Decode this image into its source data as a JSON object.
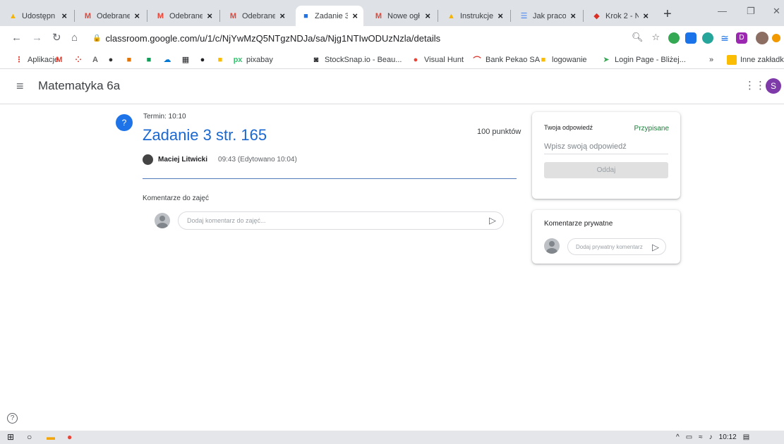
{
  "tabs": [
    {
      "title": "Udostępn",
      "icon": "google-drive-icon",
      "color": "#f4b400"
    },
    {
      "title": "Odebrane",
      "icon": "gmail-icon",
      "color": "#ea4335"
    },
    {
      "title": "Odebrane",
      "icon": "gmail-icon",
      "color": "#ea4335"
    },
    {
      "title": "Odebrane",
      "icon": "gmail-icon",
      "color": "#ea4335"
    },
    {
      "title": "Zadanie 3",
      "icon": "classroom-icon",
      "color": "#1e73e8"
    },
    {
      "title": "Nowe ogł",
      "icon": "gmail-icon",
      "color": "#ea4335"
    },
    {
      "title": "Instrukcje",
      "icon": "google-drive-icon",
      "color": "#f4b400"
    },
    {
      "title": "Jak pracow",
      "icon": "google-docs-icon",
      "color": "#4285f4"
    },
    {
      "title": "Krok 2 - N",
      "icon": "stepper-icon",
      "color": "#d93025"
    }
  ],
  "url": "classroom.google.com/u/1/c/NjYwMzQ5NTgzNDJa/sa/Njg1NTIwODUzNzla/details",
  "bookmarks": [
    {
      "label": "Aplikacje",
      "icon": "apps-icon",
      "color": "#ea4335"
    },
    {
      "label": "",
      "icon": "gmail-icon",
      "color": "#ea4335"
    },
    {
      "label": "",
      "icon": "dots-grid-icon",
      "color": "#d93025"
    },
    {
      "label": "",
      "icon": "adobe-icon",
      "color": "#666666"
    },
    {
      "label": "",
      "icon": "apple-icon",
      "color": "#333333"
    },
    {
      "label": "",
      "icon": "puzzle-icon",
      "color": "#e37400"
    },
    {
      "label": "",
      "icon": "image-icon",
      "color": "#0f9d58"
    },
    {
      "label": "",
      "icon": "cloud-icon",
      "color": "#0078d4"
    },
    {
      "label": "",
      "icon": "grid-square-icon",
      "color": "#202124"
    },
    {
      "label": "",
      "icon": "spotify-icon",
      "color": "#202124"
    },
    {
      "label": "",
      "icon": "bookmark-yellow-icon",
      "color": "#fbbc04"
    },
    {
      "label": "pixabay",
      "icon": "pixabay-icon",
      "color": "#2ec66d"
    },
    {
      "label": "StockSnap.io - Beau...",
      "icon": "camera-icon",
      "color": "#202124"
    },
    {
      "label": "Visual Hunt",
      "icon": "visualhunt-icon",
      "color": "#ea4335"
    },
    {
      "label": "Bank Pekao SA",
      "icon": "pekao-icon",
      "color": "#d93025"
    },
    {
      "label": "logowanie",
      "icon": "folder-icon",
      "color": "#fbbc04"
    },
    {
      "label": "Login Page - Bliżej...",
      "icon": "bird-icon",
      "color": "#34a853"
    }
  ],
  "bookmarks_more": "»",
  "other_bookmarks": "Inne zakładki",
  "class_name": "Matematyka 6a",
  "user_initial": "S",
  "assignment": {
    "due": "Termin: 10:10",
    "title": "Zadanie 3 str. 165",
    "points": "100 punktów",
    "author": "Maciej Litwicki",
    "posted": "09:43 (Edytowano 10:04)"
  },
  "class_comments": {
    "label": "Komentarze do zajęć",
    "placeholder": "Dodaj komentarz do zajęć..."
  },
  "your_work": {
    "title": "Twoja odpowiedź",
    "status": "Przypisane",
    "placeholder": "Wpisz swoją odpowiedź",
    "button": "Oddaj"
  },
  "private_comments": {
    "title": "Komentarze prywatne",
    "placeholder": "Dodaj prywatny komentarz"
  },
  "taskbar": {
    "time": "10:12"
  },
  "colors": {
    "accent": "#1967d2",
    "status_green": "#188038"
  }
}
